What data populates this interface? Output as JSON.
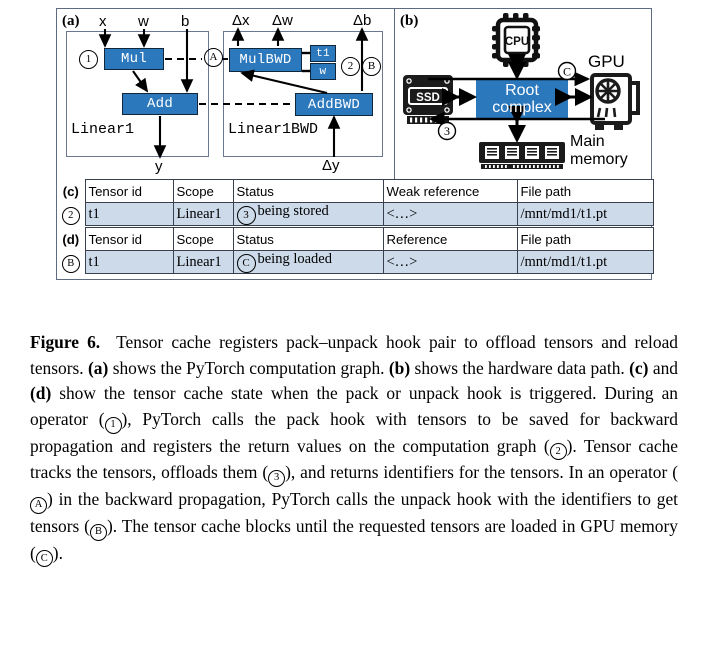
{
  "figure": {
    "panel_a": {
      "tag": "(a)",
      "inputs": [
        "x",
        "w",
        "b"
      ],
      "grad_inputs": [
        "Δx",
        "Δw",
        "Δb"
      ],
      "output": "y",
      "grad_output": "Δy",
      "fwd_scope": "Linear1",
      "bwd_scope": "Linear1BWD",
      "ops": [
        "Mul",
        "Add"
      ],
      "bwd_ops": [
        "MulBWD",
        "AddBWD"
      ],
      "saved_tensors": [
        "t1",
        "w"
      ],
      "markers": [
        "1",
        "A",
        "2",
        "B"
      ]
    },
    "panel_b": {
      "tag": "(b)",
      "cpu": "CPU",
      "ssd": "SSD",
      "root": [
        "Root",
        "complex"
      ],
      "gpu": "GPU",
      "memory": [
        "Main",
        "memory"
      ],
      "markers": [
        "3",
        "C"
      ]
    },
    "table_c": {
      "tag": "(c)",
      "row_marker": "2",
      "headers": [
        "Tensor id",
        "Scope",
        "Status",
        "Weak reference",
        "File path"
      ],
      "row": {
        "tensor_id": "t1",
        "scope": "Linear1",
        "status_marker": "3",
        "status": "being stored",
        "reference": "<…>",
        "file_path": "/mnt/md1/t1.pt"
      }
    },
    "table_d": {
      "tag": "(d)",
      "row_marker": "B",
      "headers": [
        "Tensor id",
        "Scope",
        "Status",
        "Reference",
        "File path"
      ],
      "row": {
        "tensor_id": "t1",
        "scope": "Linear1",
        "status_marker": "C",
        "status": "being loaded",
        "reference": "<…>",
        "file_path": "/mnt/md1/t1.pt"
      }
    }
  },
  "caption": {
    "label": "Figure 6.",
    "s1": "Tensor cache registers pack–unpack hook pair to offload tensors and reload tensors.",
    "a": "(a)",
    "s2": "shows the PyTorch computation graph.",
    "b": "(b)",
    "s3": "shows the hardware data path.",
    "c": "(c)",
    "and": "and",
    "d": "(d)",
    "s4": "show the tensor cache state when the pack or unpack hook is triggered. During an operator (",
    "m1": "1",
    "s5": "), PyTorch calls the pack hook with tensors to be saved for backward propagation and registers the return values on the computation graph (",
    "m2": "2",
    "s6": "). Tensor cache tracks the tensors, offloads them (",
    "m3": "3",
    "s7": "), and returns identifiers for the tensors. In an operator (",
    "m4": "A",
    "s8": ") in the backward propagation, PyTorch calls the unpack hook with the identifiers to get tensors (",
    "m5": "B",
    "s9": "). The tensor cache blocks until the requested tensors are loaded in GPU memory (",
    "m6": "C",
    "s10": ")."
  },
  "colors": {
    "op_blue": "#2c78bd",
    "row_blue": "#ccdaea",
    "frame": "#5d6b80",
    "dark": "#1b1b1b"
  }
}
